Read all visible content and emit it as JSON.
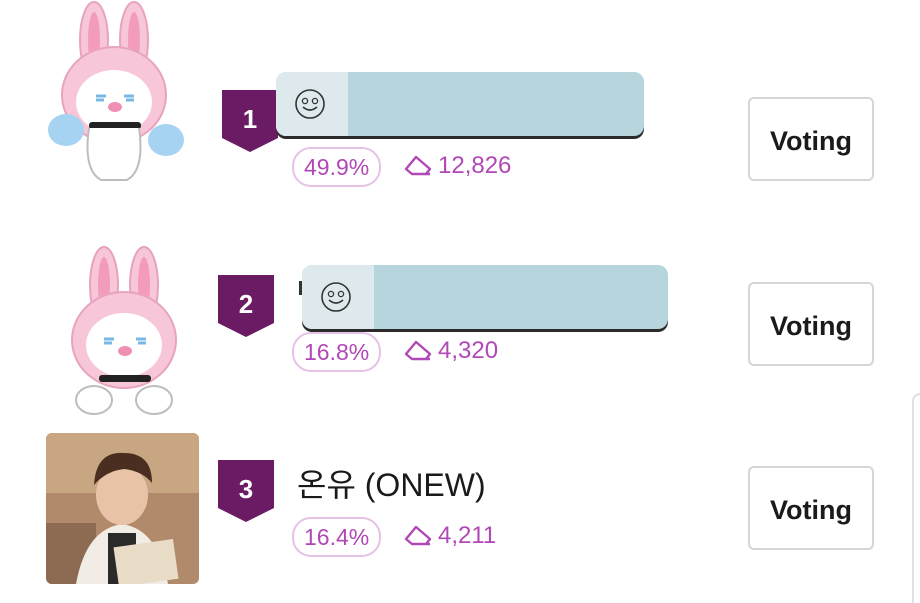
{
  "colors": {
    "badge": "#6a1b63",
    "accent": "#b248b7",
    "bar_fill": "#b6d5dc",
    "bar_lead": "#dde9ec",
    "pill_border": "#e5c2e6"
  },
  "rows": [
    {
      "rank": "1",
      "name": "",
      "percent": "49.9%",
      "votes": "12,826",
      "button": "Voting",
      "avatar_icon": "pink-bunny-icon",
      "bar_icon": "smiley-face-icon"
    },
    {
      "rank": "2",
      "name": "",
      "percent": "16.8%",
      "votes": "4,320",
      "button": "Voting",
      "avatar_icon": "pink-bunny-icon",
      "bar_icon": "smiley-face-icon"
    },
    {
      "rank": "3",
      "name": "온유 (ONEW)",
      "percent": "16.4%",
      "votes": "4,211",
      "button": "Voting",
      "avatar_icon": "profile-photo"
    }
  ]
}
